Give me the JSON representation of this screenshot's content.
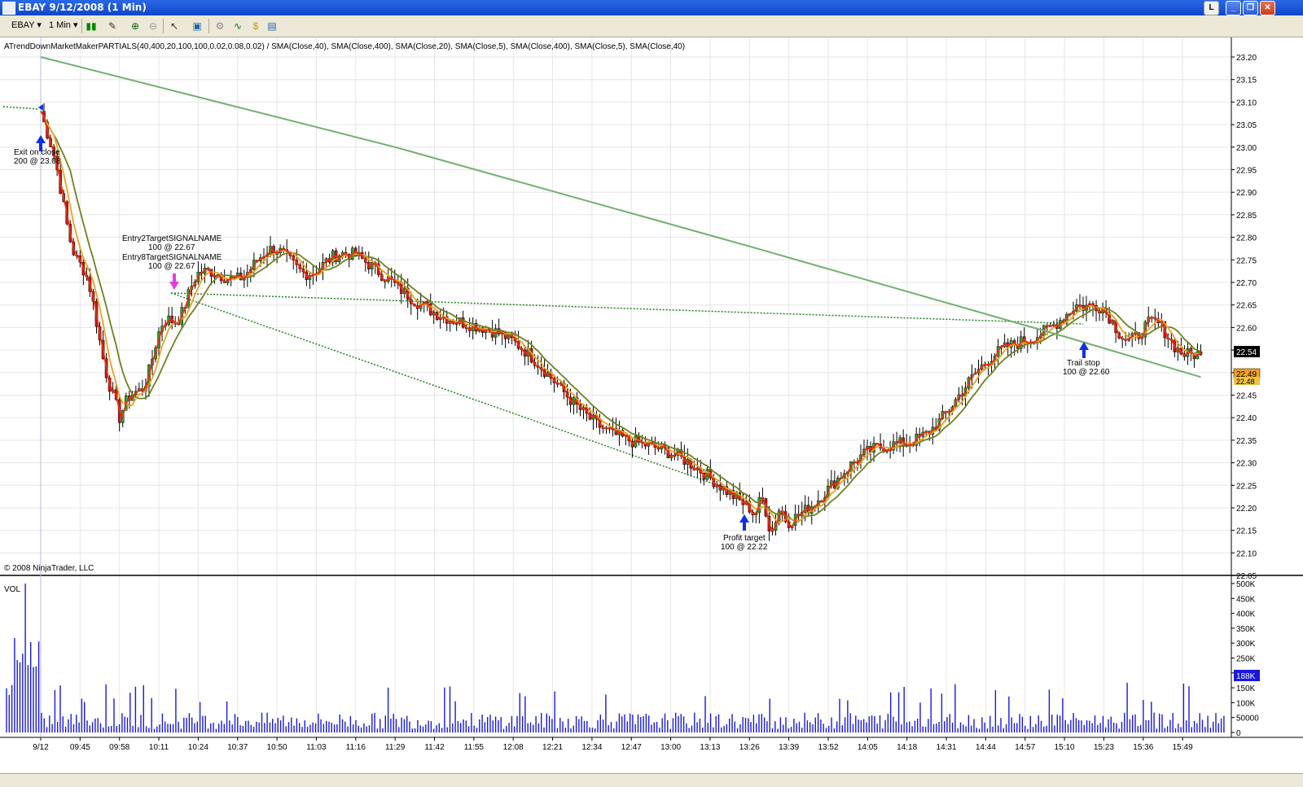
{
  "window": {
    "title": "EBAY  9/12/2008 (1 Min)",
    "buttons": [
      "L",
      "_",
      "❐",
      "✕"
    ]
  },
  "toolbar": {
    "instrument": "EBAY",
    "interval": "1 Min"
  },
  "chart": {
    "indicator_caption": "ATrendDownMarketMakerPARTIALS(40,400,20,100,100,0.02,0.08,0.02) / SMA(Close,40), SMA(Close,400), SMA(Close,20), SMA(Close,5), SMA(Close,400), SMA(Close,5), SMA(Close,40)",
    "copyright": "© 2008 NinjaTrader, LLC",
    "volume_label": "VOL",
    "price_ticks": [
      "23.20",
      "23.15",
      "23.10",
      "23.05",
      "23.00",
      "22.95",
      "22.90",
      "22.85",
      "22.80",
      "22.75",
      "22.70",
      "22.65",
      "22.60",
      "22.55",
      "22.50",
      "22.45",
      "22.40",
      "22.35",
      "22.30",
      "22.25",
      "22.20",
      "22.15",
      "22.10",
      "22.05"
    ],
    "volume_ticks": [
      "500K",
      "450K",
      "400K",
      "350K",
      "300K",
      "250K",
      "200K",
      "150K",
      "100K",
      "50000",
      "0"
    ],
    "time_ticks": [
      "9/12",
      "09:45",
      "09:58",
      "10:11",
      "10:24",
      "10:37",
      "10:50",
      "11:03",
      "11:16",
      "11:29",
      "11:42",
      "11:55",
      "12:08",
      "12:21",
      "12:34",
      "12:47",
      "13:00",
      "13:13",
      "13:26",
      "13:39",
      "13:52",
      "14:05",
      "14:18",
      "14:31",
      "14:44",
      "14:57",
      "15:10",
      "15:23",
      "15:36",
      "15:49"
    ],
    "last_price": "22.54",
    "sma_label_1": "22.49",
    "sma_label_2": "22.48",
    "last_volume": "188K",
    "annotations": [
      {
        "line1": "Exit on close",
        "line2": "200 @ 23.08"
      },
      {
        "line1": "Entry2TargetSIGNALNAME",
        "line2": "100 @ 22.67"
      },
      {
        "line1": "Entry8TargetSIGNALNAME",
        "line2": "100 @ 22.67"
      },
      {
        "line1": "Profit target",
        "line2": "100 @ 22.22"
      },
      {
        "line1": "Trail stop",
        "line2": "100 @ 22.60"
      }
    ],
    "colors": {
      "up_candle": "#2e9a2e",
      "down_candle": "#c01818",
      "sma5": "#e83010",
      "sma20": "#f0a020",
      "sma40": "#708020",
      "sma400": "#70b070",
      "volume": "#1818e0",
      "trendline": "#208020"
    }
  },
  "chart_data": {
    "type": "candlestick",
    "symbol": "EBAY",
    "interval": "1 Min",
    "date": "9/12/2008",
    "ylim": [
      22.05,
      23.22
    ],
    "key_prices": [
      {
        "time": "9/12",
        "price": 23.08
      },
      {
        "time": "09:58",
        "price": 22.4
      },
      {
        "time": "10:24",
        "price": 22.72
      },
      {
        "time": "11:16",
        "price": 22.76
      },
      {
        "time": "13:26",
        "price": 22.2
      },
      {
        "time": "13:39",
        "price": 22.17
      },
      {
        "time": "15:14",
        "price": 22.65
      },
      {
        "time": "15:55",
        "price": 22.54
      }
    ],
    "sma400": [
      {
        "time": "9/12",
        "price": 23.2
      },
      {
        "time": "11:29",
        "price": 23.0
      },
      {
        "time": "13:26",
        "price": 22.78
      },
      {
        "time": "15:10",
        "price": 22.58
      },
      {
        "time": "15:55",
        "price": 22.49
      }
    ],
    "volume_max": 500000
  }
}
